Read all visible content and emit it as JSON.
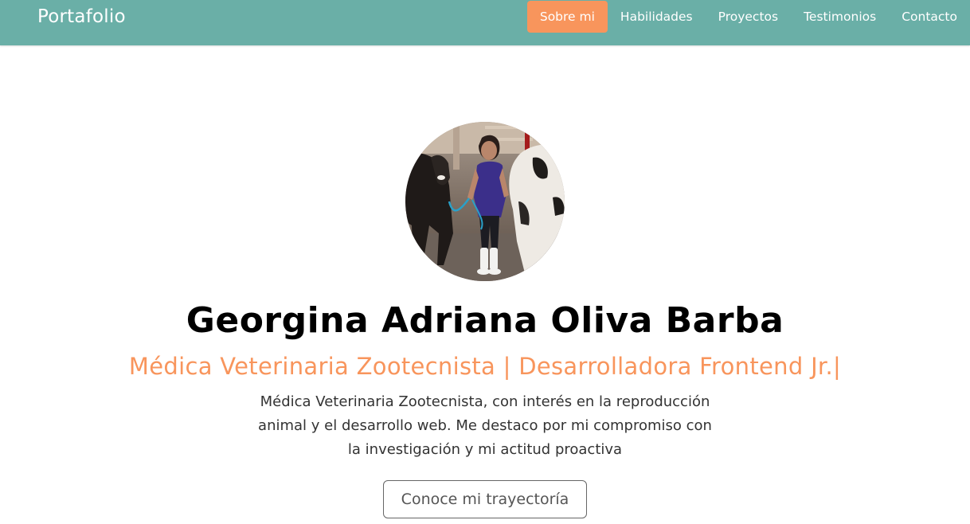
{
  "navbar": {
    "brand": "Portafolio",
    "items": [
      {
        "label": "Sobre mi",
        "active": true
      },
      {
        "label": "Habilidades",
        "active": false
      },
      {
        "label": "Proyectos",
        "active": false
      },
      {
        "label": "Testimonios",
        "active": false
      },
      {
        "label": "Contacto",
        "active": false
      }
    ]
  },
  "hero": {
    "name": "Georgina Adriana Oliva Barba",
    "subtitle": "Médica Veterinaria Zootecnista | Desarrolladora Frontend Jr.",
    "cursor": "|",
    "description": "Médica Veterinaria Zootecnista, con interés en la reproducción animal y el desarrollo web. Me destaco por mi compromiso con la investigación y mi actitud proactiva",
    "cta_label": "Conoce mi trayectoría"
  },
  "colors": {
    "navbar_bg": "#6aafa7",
    "accent": "#f8955c",
    "text": "#000000"
  }
}
